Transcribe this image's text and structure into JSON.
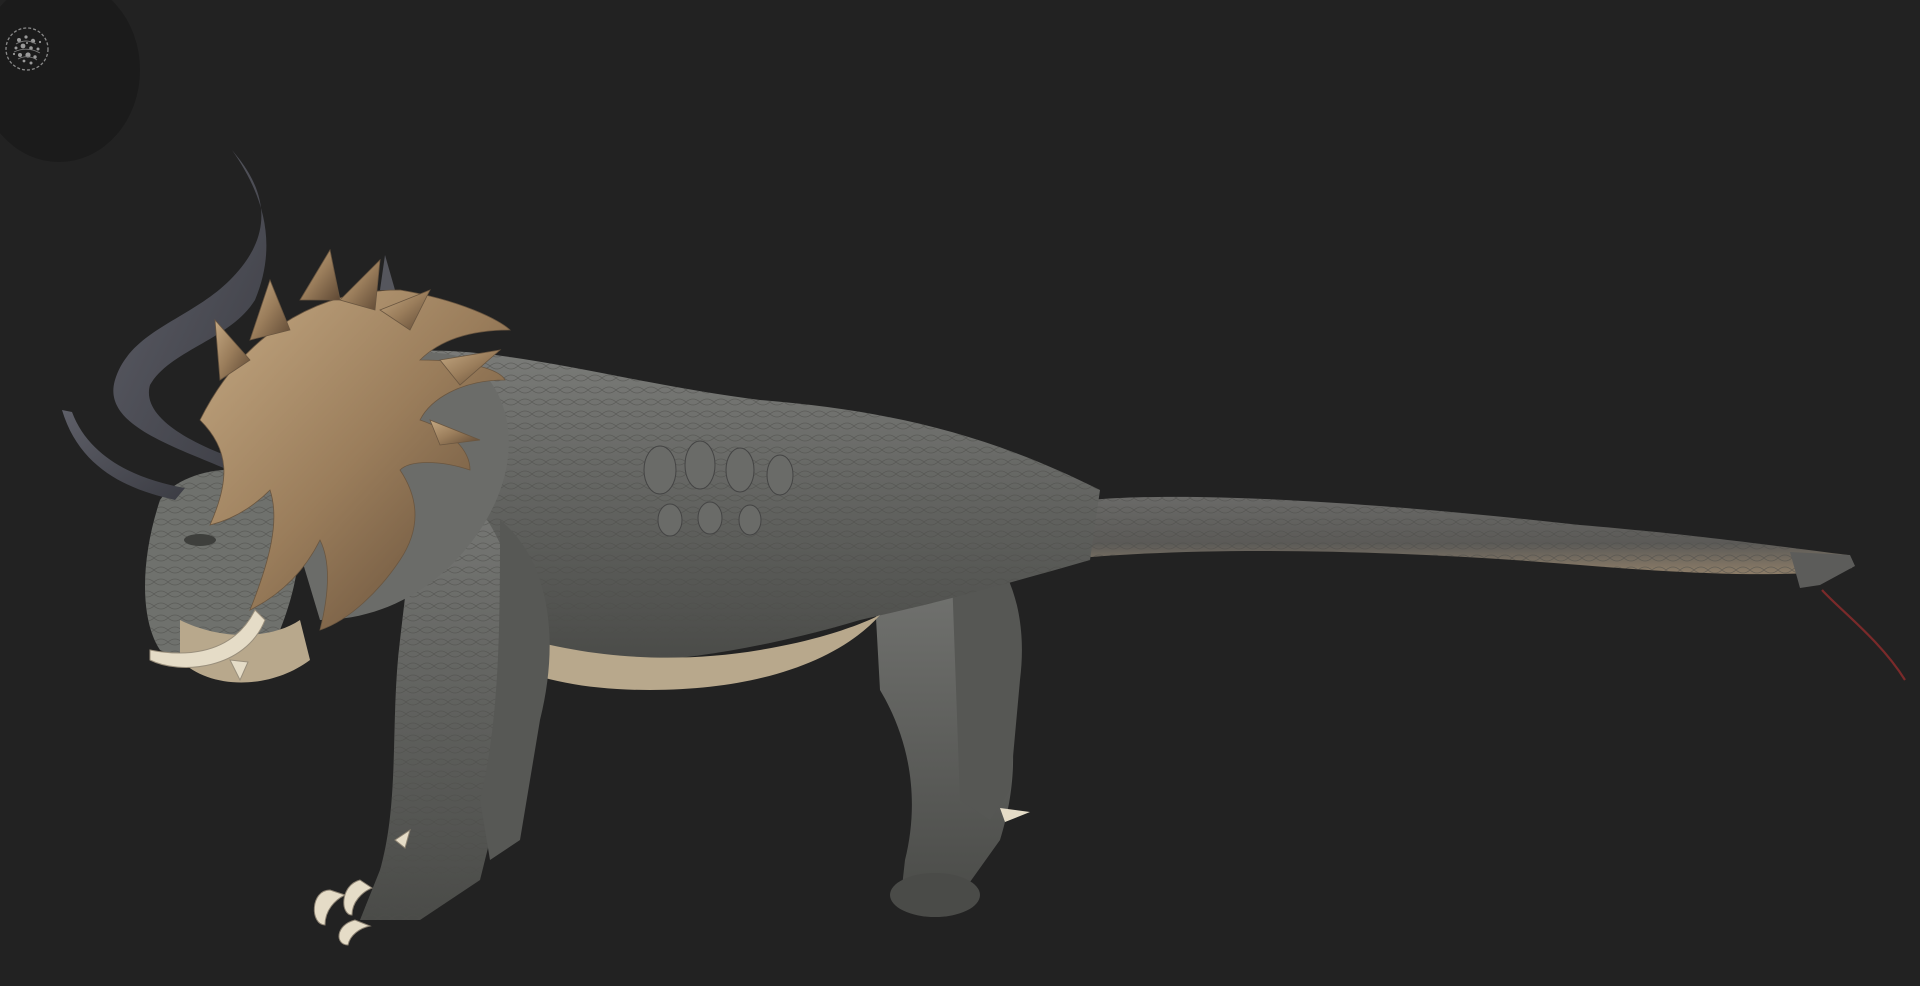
{
  "viewer": {
    "background_color": "#222222",
    "widget_color": "#1b1b1b"
  },
  "toolbar": {
    "icon": "matcap-sphere-icon"
  },
  "model": {
    "subject": "creature-3d-model",
    "skin_color": "#6d6e6b",
    "belly_color": "#b8a88c",
    "mane_color": "#9a7f5e",
    "horn_color": "#4f5058",
    "tusk_color": "#e5dcc7"
  }
}
